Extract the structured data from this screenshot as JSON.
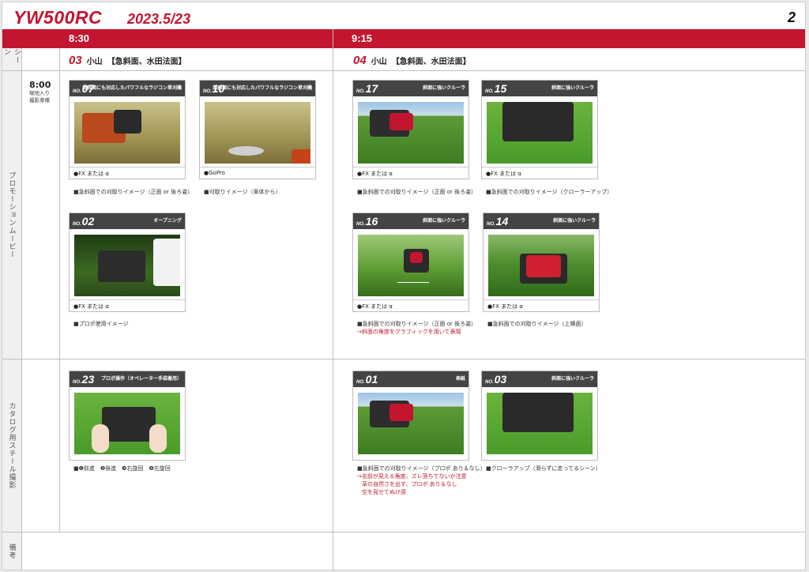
{
  "header": {
    "title": "YW500RC",
    "date": "2023.5/23",
    "page_number": "2"
  },
  "columns": {
    "time_left": "8:30",
    "time_right": "9:15"
  },
  "scenes": {
    "label": "シーン",
    "left": {
      "num": "03",
      "place": "小山",
      "desc": "【急斜面、水田法面】"
    },
    "right": {
      "num": "04",
      "place": "小山",
      "desc": "【急斜面、水田法面】"
    }
  },
  "rows": {
    "promo": "プロモーションムービー",
    "catalog": "カタログ用スチール撮影",
    "notes": "備考"
  },
  "schedule": {
    "time": "8:00",
    "note1": "現地入り",
    "note2": "撮影準備"
  },
  "cards": {
    "c07": {
      "no": "07",
      "cap": "急斜面にも対応したパワフルなラジコン草刈機",
      "note": "●FX または α",
      "desc": "■急斜面での刈取りイメージ（正面 or 後ろ姿）"
    },
    "c10": {
      "no": "10",
      "cap": "急斜面にも対応したパワフルなラジコン草刈機",
      "note": "●GoPro",
      "desc": "■刈取りイメージ（車体から）"
    },
    "c02": {
      "no": "02",
      "cap": "オープニング",
      "note": "●FX または α",
      "desc": "■プロポ使用イメージ"
    },
    "c17": {
      "no": "17",
      "cap": "斜面に強いクルーラ",
      "note": "●FX または α",
      "desc": "■急斜面での刈取りイメージ（正面 or 後ろ姿）"
    },
    "c15": {
      "no": "15",
      "cap": "斜面に強いクルーラ",
      "note": "●FX または α",
      "desc": "■急斜面での刈取りイメージ（クローラーアップ）"
    },
    "c16": {
      "no": "16",
      "cap": "斜面に強いクルーラ",
      "note": "●FX または α",
      "desc": "■急斜面での刈取りイメージ（正面 or 後ろ姿）",
      "desc2": "→斜面の角度をグラフィックを用いて表現"
    },
    "c14": {
      "no": "14",
      "cap": "斜面に強いクルーラ",
      "note": "●FX または α",
      "desc": "■急斜面での刈取りイメージ（上横面）"
    },
    "c23": {
      "no": "23",
      "cap": "プロポ操作（オペレーター手袋着用）",
      "desc": "■❶前進　❷後進　❸右旋回　❹左旋回"
    },
    "c01": {
      "no": "01",
      "cap": "表紙",
      "desc": "■急斜面での刈取りイメージ（プロポ あり＆なし）",
      "desc2": "→名前が見える角度、ズレ落ちてないか注意",
      "desc3": "草の自然さを出す、プロポ あり＆なし",
      "desc4": "空を見せてぬけ感"
    },
    "c03": {
      "no": "03",
      "cap": "斜面に強いクルーラ",
      "desc": "■クローラアップ（滑らずに走ってるシーン）"
    }
  },
  "no_prefix": "NO.",
  "colors": {
    "accent": "#c3152f",
    "card_bar": "#444444"
  }
}
